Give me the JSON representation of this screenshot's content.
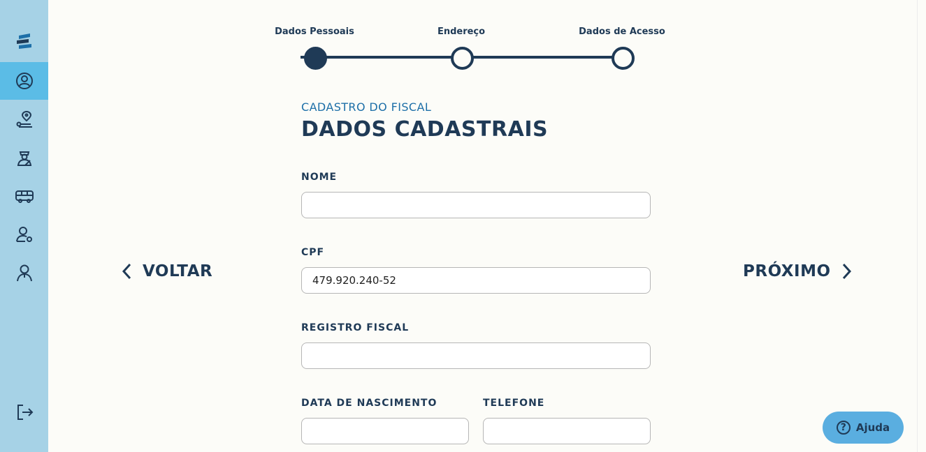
{
  "sidebar": {
    "logo_icon": "app-logo-icon",
    "items": [
      {
        "icon": "user-circle-icon",
        "active": true
      },
      {
        "icon": "location-route-icon",
        "active": false
      },
      {
        "icon": "inspector-icon",
        "active": false
      },
      {
        "icon": "bus-icon",
        "active": false
      },
      {
        "icon": "user-key-icon",
        "active": false
      },
      {
        "icon": "person-icon",
        "active": false
      }
    ],
    "logout_icon": "logout-icon"
  },
  "stepper": {
    "steps": [
      {
        "label": "Dados Pessoais",
        "status": "current"
      },
      {
        "label": "Endereço",
        "status": "pending"
      },
      {
        "label": "Dados de Acesso",
        "status": "pending"
      }
    ]
  },
  "form": {
    "subtitle": "CADASTRO DO FISCAL",
    "title": "DADOS CADASTRAIS",
    "fields": {
      "nome": {
        "label": "NOME",
        "value": ""
      },
      "cpf": {
        "label": "CPF",
        "value": "479.920.240-52"
      },
      "registro": {
        "label": "REGISTRO FISCAL",
        "value": ""
      },
      "nascimento": {
        "label": "DATA DE NASCIMENTO",
        "value": ""
      },
      "telefone": {
        "label": "TELEFONE",
        "value": ""
      }
    }
  },
  "navigation": {
    "back_label": "VOLTAR",
    "next_label": "PRÓXIMO"
  },
  "help": {
    "label": "Ajuda",
    "icon_glyph": "?"
  },
  "colors": {
    "primary": "#1f3a56",
    "sidebar": "#a6d2e6",
    "sidebar_active": "#5bbce6",
    "accent": "#1d6fa8",
    "help_button": "#5aaee0"
  }
}
